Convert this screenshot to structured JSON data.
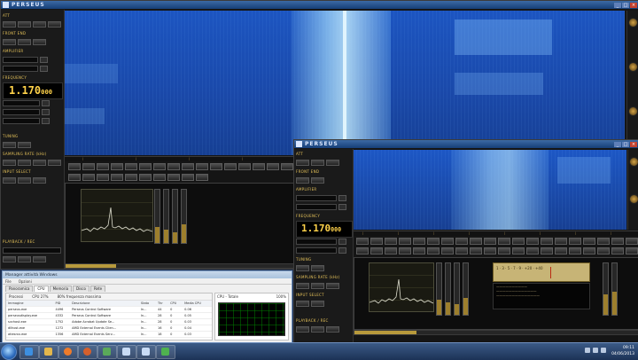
{
  "sdr_main": {
    "title": "PERSEUS",
    "labels": {
      "att": "ATT",
      "front_end": "FRONT END",
      "amplifier": "AMPLIFIER",
      "frequency": "FREQUENCY",
      "tuning": "TUNING",
      "sampling_rate": "SAMPLING RATE (kHz)",
      "input_select": "INPUT SELECT",
      "playback_rec": "PLAYBACK / REC"
    },
    "frequency_main": "1.170",
    "frequency_sub": "000"
  },
  "sdr_second": {
    "title": "PERSEUS",
    "labels": {
      "att": "ATT",
      "front_end": "FRONT END",
      "amplifier": "AMPLIFIER",
      "frequency": "FREQUENCY",
      "tuning": "TUNING",
      "sampling_rate": "SAMPLING RATE (kHz)",
      "input_select": "INPUT SELECT",
      "playback_rec": "PLAYBACK / REC"
    },
    "frequency_main": "1.170",
    "frequency_sub": "000"
  },
  "task_manager": {
    "title": "Manager attività Windows",
    "menu": [
      "File",
      "Opzioni"
    ],
    "tabs": [
      "Panoramica",
      "CPU",
      "Memoria",
      "Disco",
      "Rete"
    ],
    "active_tab": "CPU",
    "sub_processes": "Processi",
    "sub_cpu": "CPU 27%",
    "sub_freq": "80% frequenza massima",
    "columns": [
      "Immagine",
      "PID",
      "Descrizione",
      "Stato",
      "Thr",
      "CPU",
      "Media CPU"
    ],
    "rows": [
      [
        "perseus.exe",
        "4496",
        "Perseus Control Software",
        "In...",
        "44",
        "0",
        "0.06"
      ],
      [
        "perseusdisplay.exe",
        "4332",
        "Perseus Control Software",
        "In...",
        "28",
        "0",
        "0.05"
      ],
      [
        "svchost.exe",
        "1752",
        "Adobe Acrobat Update Se...",
        "In...",
        "28",
        "0",
        "0.03"
      ],
      [
        "dllhost.exe",
        "1272",
        "AMD External Events Clien...",
        "In...",
        "16",
        "0",
        "0.04"
      ],
      [
        "atiesrxx.exe",
        "1356",
        "AMD External Events Serv...",
        "In...",
        "18",
        "0",
        "0.03"
      ]
    ],
    "right_header": "CPU - Totale",
    "right_value": "100%",
    "right_view": "Visualizza"
  },
  "taskbar": {
    "time": "09:11",
    "date": "04/06/2013"
  },
  "colors": {
    "waterfall": "#1b4fb5",
    "accent_gold": "#e5c25a",
    "panel": "#151515"
  }
}
